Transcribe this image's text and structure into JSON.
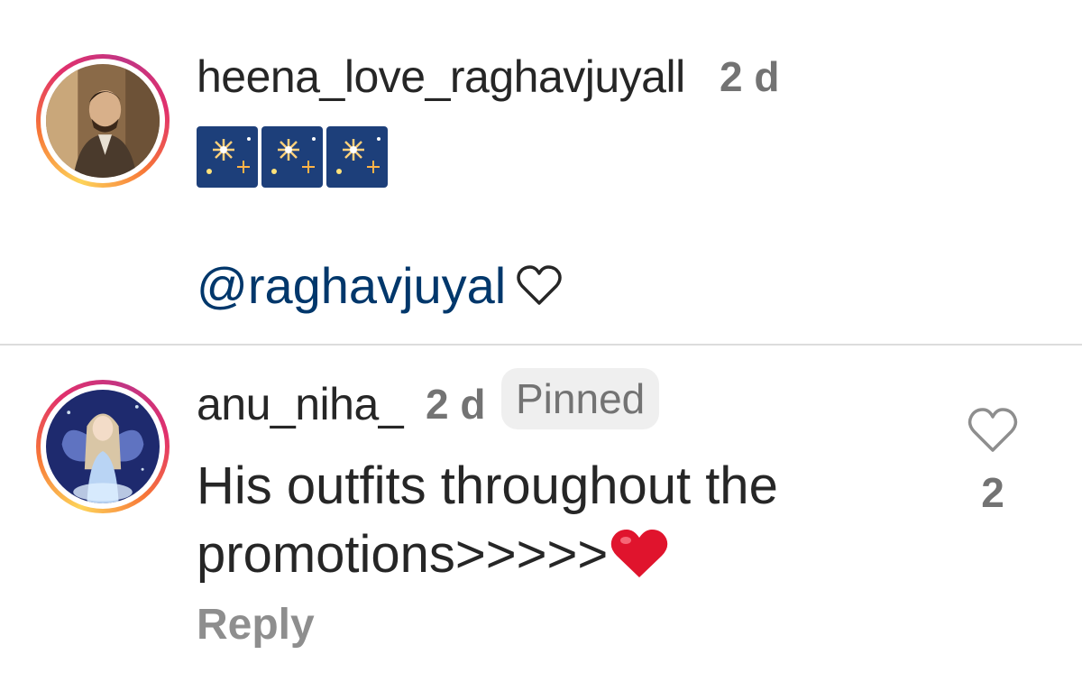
{
  "comments": [
    {
      "username": "heena_love_raghavjuyall",
      "time": "2 d",
      "emoji": [
        "fireworks-emoji",
        "fireworks-emoji",
        "fireworks-emoji"
      ],
      "mention": "@raghavjuyal",
      "mention_suffix_icon": "heart-outline-icon"
    },
    {
      "username": "anu_niha_",
      "time": "2 d",
      "badge": "Pinned",
      "text": "His outfits throughout the promotions>>>>>",
      "text_suffix_icon": "red-heart-emoji",
      "reply_label": "Reply",
      "like_icon": "heart-outline-icon",
      "like_count": "2"
    }
  ],
  "colors": {
    "text": "#262626",
    "meta": "#737373",
    "mention": "#00376b",
    "divider": "#dcdcdc",
    "pinned_bg": "#efefef",
    "heart_red": "#e0142d"
  }
}
